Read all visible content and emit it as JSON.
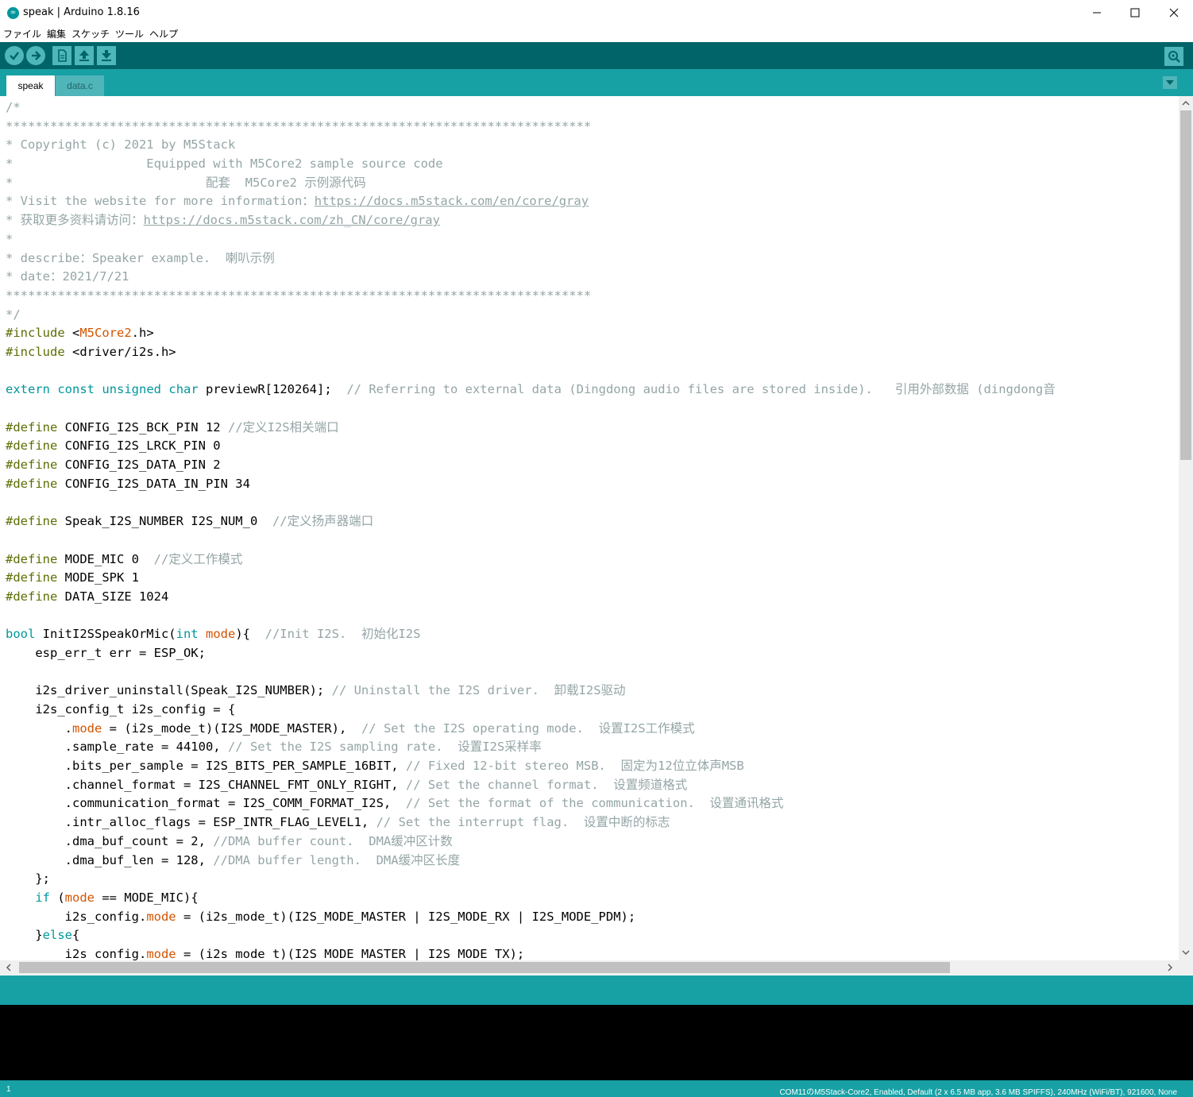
{
  "window": {
    "title": "speak | Arduino 1.8.16",
    "logo_icon": "arduino-logo-icon",
    "controls": [
      "minimize-icon",
      "maximize-icon",
      "close-icon"
    ]
  },
  "menu": [
    "ファイル",
    "編集",
    "スケッチ",
    "ツール",
    "ヘルプ"
  ],
  "toolbar": {
    "buttons": [
      "verify-icon",
      "upload-icon",
      "new-icon",
      "open-icon",
      "save-icon"
    ],
    "serial_monitor": "serial-monitor-icon"
  },
  "tabs": [
    {
      "label": "speak",
      "active": true
    },
    {
      "label": "data.c",
      "active": false
    }
  ],
  "code": {
    "lines": [
      "/*",
      "*******************************************************************************",
      "* Copyright (c) 2021 by M5Stack",
      "*                  Equipped with M5Core2 sample source code",
      "*                          配套  M5Core2 示例源代码",
      "* Visit the website for more information：https://docs.m5stack.com/en/core/gray",
      "* 获取更多资料请访问：https://docs.m5stack.com/zh_CN/core/gray",
      "*",
      "* describe：Speaker example.  喇叭示例",
      "* date：2021/7/21",
      "*******************************************************************************",
      "*/",
      "#include <M5Core2.h>",
      "#include <driver/i2s.h>",
      "",
      "extern const unsigned char previewR[120264];  // Referring to external data (Dingdong audio files are stored inside).   引用外部数据 (dingdong音",
      "",
      "#define CONFIG_I2S_BCK_PIN 12 //定义I2S相关端口",
      "#define CONFIG_I2S_LRCK_PIN 0",
      "#define CONFIG_I2S_DATA_PIN 2",
      "#define CONFIG_I2S_DATA_IN_PIN 34",
      "",
      "#define Speak_I2S_NUMBER I2S_NUM_0  //定义扬声器端口",
      "",
      "#define MODE_MIC 0  //定义工作模式",
      "#define MODE_SPK 1",
      "#define DATA_SIZE 1024",
      "",
      "bool InitI2SSpeakOrMic(int mode){  //Init I2S.  初始化I2S",
      "    esp_err_t err = ESP_OK;",
      "",
      "    i2s_driver_uninstall(Speak_I2S_NUMBER); // Uninstall the I2S driver.  卸载I2S驱动",
      "    i2s_config_t i2s_config = {",
      "        .mode = (i2s_mode_t)(I2S_MODE_MASTER),  // Set the I2S operating mode.  设置I2S工作模式",
      "        .sample_rate = 44100, // Set the I2S sampling rate.  设置I2S采样率",
      "        .bits_per_sample = I2S_BITS_PER_SAMPLE_16BIT, // Fixed 12-bit stereo MSB.  固定为12位立体声MSB",
      "        .channel_format = I2S_CHANNEL_FMT_ONLY_RIGHT, // Set the channel format.  设置频道格式",
      "        .communication_format = I2S_COMM_FORMAT_I2S,  // Set the format of the communication.  设置通讯格式",
      "        .intr_alloc_flags = ESP_INTR_FLAG_LEVEL1, // Set the interrupt flag.  设置中断的标志",
      "        .dma_buf_count = 2, //DMA buffer count.  DMA缓冲区计数",
      "        .dma_buf_len = 128, //DMA buffer length.  DMA缓冲区长度",
      "    };",
      "    if (mode == MODE_MIC){",
      "        i2s_config.mode = (i2s_mode_t)(I2S_MODE_MASTER | I2S_MODE_RX | I2S_MODE_PDM);",
      "    }else{",
      "        i2s_config.mode = (i2s_mode_t)(I2S_MODE_MASTER | I2S_MODE_TX);"
    ]
  },
  "status": {
    "line": "1",
    "board": "COM11のM5Stack-Core2, Enabled, Default (2 x 6.5 MB app, 3.6 MB SPIFFS), 240MHz (WiFi/BT), 921600, None"
  },
  "colors": {
    "toolbar": "#006468",
    "tabbar": "#17a1a5",
    "button": "#4db7bb",
    "comment": "#95a5a6",
    "keyword": "#00979c",
    "preprocessor": "#5e6d03",
    "library": "#d35400"
  }
}
